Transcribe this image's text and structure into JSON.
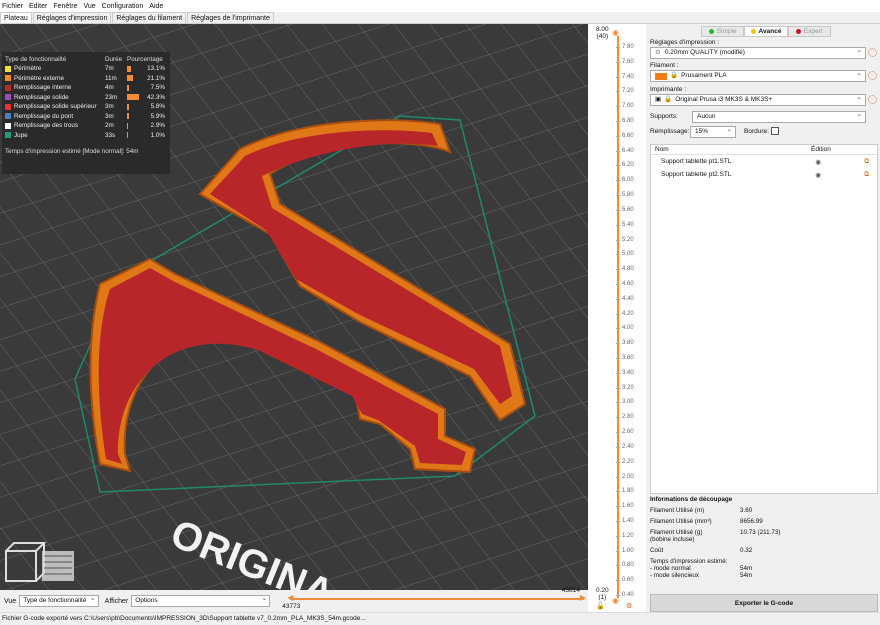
{
  "menu": [
    "Fichier",
    "Editer",
    "Fenêtre",
    "Vue",
    "Configuration",
    "Aide"
  ],
  "tabs": [
    "Plateau",
    "Réglages d'impression",
    "Réglages du filament",
    "Réglages de l'imprimante"
  ],
  "legend": {
    "headers": [
      "Type de fonctionnalité",
      "Durée",
      "Pourcentage"
    ],
    "rows": [
      {
        "name": "Périmètre",
        "duration": "7m",
        "percent": "13.1%",
        "fraction": 0.131,
        "color": "#f2e33a"
      },
      {
        "name": "Périmètre externe",
        "duration": "11m",
        "percent": "21.1%",
        "fraction": 0.211,
        "color": "#f58c23"
      },
      {
        "name": "Remplissage interne",
        "duration": "4m",
        "percent": "7.5%",
        "fraction": 0.075,
        "color": "#b03028"
      },
      {
        "name": "Remplissage solide",
        "duration": "23m",
        "percent": "42.3%",
        "fraction": 0.423,
        "color": "#a04ac0"
      },
      {
        "name": "Remplissage solide supérieur",
        "duration": "3m",
        "percent": "5.8%",
        "fraction": 0.058,
        "color": "#e8322c"
      },
      {
        "name": "Remplissage du pont",
        "duration": "3m",
        "percent": "5.9%",
        "fraction": 0.059,
        "color": "#4a7fc0"
      },
      {
        "name": "Remplissage des trous",
        "duration": "2m",
        "percent": "2.9%",
        "fraction": 0.029,
        "color": "#ffffff"
      },
      {
        "name": "Jupe",
        "duration": "33s",
        "percent": "1.0%",
        "fraction": 0.01,
        "color": "#1f9c7c"
      }
    ],
    "time_estimate": "Temps d'impression estimé [Mode normal]:  54m"
  },
  "viewport": {
    "bed_text": "ORIGINA"
  },
  "bottom": {
    "view_label": "Vue",
    "view_value": "Type de fonctionnalité",
    "show_label": "Afficher",
    "show_value": "Options",
    "slider_max": "43814",
    "slider_min": "43773"
  },
  "vertical_slider": {
    "top_value": "8.00",
    "top_layer": "(40)",
    "bottom_value": "0.20",
    "bottom_layer": "(1)",
    "ticks": [
      "7.80",
      "7.60",
      "7.40",
      "7.20",
      "7.00",
      "6.80",
      "6.60",
      "6.40",
      "6.20",
      "6.00",
      "5.80",
      "5.60",
      "5.40",
      "5.20",
      "5.00",
      "4.80",
      "4.60",
      "4.40",
      "4.20",
      "4.00",
      "3.80",
      "3.60",
      "3.40",
      "3.20",
      "3.00",
      "2.80",
      "2.60",
      "2.40",
      "2.20",
      "2.00",
      "1.80",
      "1.60",
      "1.40",
      "1.20",
      "1.00",
      "0.80",
      "0.60",
      "0.40"
    ]
  },
  "sidebar": {
    "modes": [
      {
        "label": "Simple",
        "color": "#2ab52a",
        "active": false
      },
      {
        "label": "Avancé",
        "color": "#e8c80c",
        "active": true
      },
      {
        "label": "Expert",
        "color": "#d01010",
        "active": false
      }
    ],
    "print_settings_label": "Réglages d'impression :",
    "print_settings_value": "0.20mm QUALITY (modifié)",
    "filament_label": "Filament :",
    "filament_value": "Prusament PLA",
    "filament_color": "#f07b10",
    "printer_label": "Imprimante :",
    "printer_value": "Original Prusa i3 MK3S & MK3S+",
    "supports_label": "Supports:",
    "supports_value": "Aucun",
    "infill_label": "Remplissage:",
    "infill_value": "15%",
    "brim_label": "Bordure:",
    "objects_header_name": "Nom",
    "objects_header_edit": "Édition",
    "objects": [
      "Support tablette pt1.STL",
      "Support tablette pt2.STL"
    ]
  },
  "slice_info": {
    "title": "Informations de découpage",
    "rows": [
      {
        "k": "Filament Utilisé (m)",
        "v": "3.60"
      },
      {
        "k": "Filament Utilisé (mm³)",
        "v": "8656.99"
      },
      {
        "k": "Filament Utilisé (g)\n     (bobine incluse)",
        "v": "10.73 (211.73)"
      },
      {
        "k": "Coût",
        "v": "0.32"
      }
    ],
    "time_title": "Temps d'impression estimé:",
    "normal_label": " - mode normal",
    "normal_value": "54m",
    "silent_label": " - mode silencieux",
    "silent_value": "54m"
  },
  "export_button": "Exporter le G-code",
  "status": "Fichier G-code exporté vers C:\\Users\\pb\\Documents\\IMPRESSION_3D\\Support tablette v7_0.2mm_PLA_MK3S_54m.gcode..."
}
